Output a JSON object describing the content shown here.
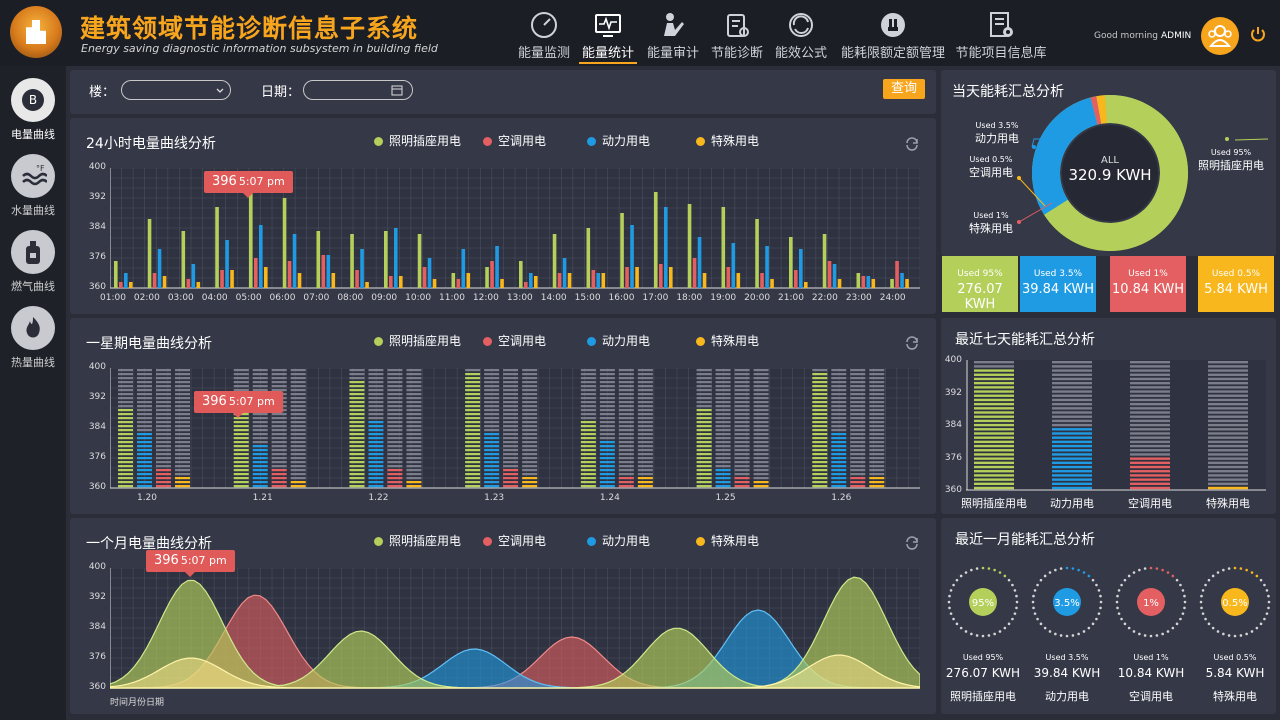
{
  "header": {
    "title": "建筑领域节能诊断信息子系统",
    "subtitle": "Energy saving diagnostic information subsystem in building field",
    "greeting": "Good morning",
    "user": "ADMIN"
  },
  "nav": [
    {
      "label": "能量监测",
      "icon": "gauge-icon"
    },
    {
      "label": "能量统计",
      "icon": "monitor-chart-icon",
      "active": true
    },
    {
      "label": "能量审计",
      "icon": "audit-icon"
    },
    {
      "label": "节能诊断",
      "icon": "clipboard-icon"
    },
    {
      "label": "能效公式",
      "icon": "globe-refresh-icon"
    },
    {
      "label": "能耗限额定额管理",
      "icon": "plug-icon"
    },
    {
      "label": "节能项目信息库",
      "icon": "document-gear-icon"
    }
  ],
  "sidebar": [
    {
      "label": "电量曲线",
      "icon": "electric-coin-icon",
      "active": true
    },
    {
      "label": "水量曲线",
      "icon": "water-temp-icon"
    },
    {
      "label": "燃气曲线",
      "icon": "gas-tank-icon"
    },
    {
      "label": "热量曲线",
      "icon": "flame-icon"
    }
  ],
  "filters": {
    "building_label": "楼：",
    "date_label": "日期：",
    "query": "查询"
  },
  "legend": [
    "照明插座用电",
    "空调用电",
    "动力用电",
    "特殊用电"
  ],
  "colors": {
    "lighting": "#b4cf5a",
    "ac": "#e35f61",
    "power": "#1f9be4",
    "special": "#f8b71c",
    "accent": "#f8a51e",
    "panel": "#353847"
  },
  "tooltip": {
    "value": "396",
    "time": "5:07 pm"
  },
  "daily": {
    "title": "24小时电量曲线分析",
    "yticks": [
      "400",
      "392",
      "384",
      "376",
      "360"
    ],
    "xticks": [
      "01:00",
      "02:00",
      "03:00",
      "04:00",
      "05:00",
      "06:00",
      "07:00",
      "08:00",
      "09:00",
      "10:00",
      "11:00",
      "12:00",
      "13:00",
      "14:00",
      "15:00",
      "16:00",
      "17:00",
      "18:00",
      "19:00",
      "20:00",
      "21:00",
      "22:00",
      "23:00",
      "24:00"
    ]
  },
  "weekly": {
    "title": "一星期电量曲线分析",
    "yticks": [
      "400",
      "392",
      "384",
      "376",
      "360"
    ],
    "xticks": [
      "1.20",
      "1.21",
      "1.22",
      "1.23",
      "1.24",
      "1.25",
      "1.26"
    ]
  },
  "monthly": {
    "title": "一个月电量曲线分析",
    "yticks": [
      "400",
      "392",
      "384",
      "376",
      "360"
    ],
    "xcaption": "时间月份日期"
  },
  "today": {
    "title": "当天能耗汇总分析",
    "center_label": "ALL",
    "center_value": "320.9 KWH",
    "items": [
      {
        "used": "Used 95%",
        "name": "照明插座用电",
        "value": "276.07 KWH",
        "color": "#b4cf5a"
      },
      {
        "used": "Used 3.5%",
        "name": "动力用电",
        "value": "39.84 KWH",
        "color": "#1f9be4"
      },
      {
        "used": "Used 1%",
        "name": "特殊用电",
        "value": "10.84 KWH",
        "color": "#e35f61"
      },
      {
        "used": "Used 0.5%",
        "name": "空调用电",
        "value": "5.84 KWH",
        "color": "#f8b71c"
      }
    ]
  },
  "seven": {
    "title": "最近七天能耗汇总分析",
    "yticks": [
      "400",
      "392",
      "384",
      "376",
      "360"
    ],
    "categories": [
      "照明插座用电",
      "动力用电",
      "空调用电",
      "特殊用电"
    ]
  },
  "month_summary": {
    "title": "最近一月能耗汇总分析",
    "items": [
      {
        "pct": "95%",
        "used": "Used 95%",
        "value": "276.07 KWH",
        "name": "照明插座用电",
        "color": "#b4cf5a"
      },
      {
        "pct": "3.5%",
        "used": "Used 3.5%",
        "value": "39.84 KWH",
        "name": "动力用电",
        "color": "#1f9be4"
      },
      {
        "pct": "1%",
        "used": "Used 1%",
        "value": "10.84 KWH",
        "name": "空调用电",
        "color": "#e35f61"
      },
      {
        "pct": "0.5%",
        "used": "Used 0.5%",
        "value": "5.84 KWH",
        "name": "特殊用电",
        "color": "#f8b71c"
      }
    ]
  },
  "chart_data": [
    {
      "type": "bar",
      "title": "24小时电量曲线分析",
      "categories": [
        "01:00",
        "02:00",
        "03:00",
        "04:00",
        "05:00",
        "06:00",
        "07:00",
        "08:00",
        "09:00",
        "10:00",
        "11:00",
        "12:00",
        "13:00",
        "14:00",
        "15:00",
        "16:00",
        "17:00",
        "18:00",
        "19:00",
        "20:00",
        "21:00",
        "22:00",
        "23:00",
        "24:00"
      ],
      "ylim": [
        360,
        400
      ],
      "series": [
        {
          "name": "照明插座用电",
          "values": [
            369,
            383,
            379,
            387,
            392,
            390,
            379,
            378,
            379,
            378,
            365,
            367,
            369,
            378,
            380,
            385,
            392,
            388,
            387,
            383,
            377,
            378,
            365,
            363
          ]
        },
        {
          "name": "空调用电",
          "values": [
            362,
            365,
            363,
            366,
            370,
            369,
            371,
            366,
            364,
            367,
            363,
            369,
            362,
            365,
            366,
            367,
            368,
            370,
            367,
            365,
            366,
            369,
            364,
            369
          ]
        },
        {
          "name": "动力用电",
          "values": [
            365,
            373,
            368,
            376,
            381,
            378,
            371,
            373,
            380,
            370,
            373,
            374,
            365,
            370,
            365,
            381,
            387,
            377,
            375,
            374,
            373,
            368,
            364,
            365
          ]
        },
        {
          "name": "特殊用电",
          "values": [
            362,
            364,
            362,
            366,
            367,
            365,
            365,
            362,
            364,
            363,
            365,
            363,
            364,
            365,
            365,
            367,
            367,
            365,
            365,
            363,
            362,
            363,
            363,
            363
          ]
        }
      ]
    },
    {
      "type": "bar",
      "title": "一星期电量曲线分析",
      "categories": [
        "1.20",
        "1.21",
        "1.22",
        "1.23",
        "1.24",
        "1.25",
        "1.26"
      ],
      "ylim": [
        360,
        400
      ],
      "series": [
        {
          "name": "照明插座用电",
          "values": [
            386,
            390,
            396,
            398,
            382,
            386,
            398
          ]
        },
        {
          "name": "动力用电",
          "values": [
            378,
            375,
            382,
            378,
            376,
            366,
            378
          ]
        },
        {
          "name": "空调用电",
          "values": [
            367,
            366,
            367,
            366,
            364,
            364,
            364
          ]
        },
        {
          "name": "特殊用电",
          "values": [
            364,
            362,
            363,
            364,
            364,
            362,
            364
          ]
        }
      ]
    },
    {
      "type": "area",
      "title": "一个月电量曲线分析",
      "ylim": [
        360,
        400
      ],
      "series": [
        {
          "name": "照明插座用电",
          "peaks": [
            [
              0.1,
              396
            ],
            [
              0.31,
              379
            ],
            [
              0.7,
              380
            ],
            [
              0.92,
              397
            ]
          ]
        },
        {
          "name": "动力用电",
          "peaks": [
            [
              0.18,
              391
            ],
            [
              0.57,
              377
            ]
          ]
        },
        {
          "name": "空调用电",
          "peaks": [
            [
              0.45,
              373
            ],
            [
              0.8,
              386
            ]
          ]
        },
        {
          "name": "特殊用电",
          "peaks": [
            [
              0.1,
              370
            ],
            [
              0.9,
              371
            ]
          ]
        }
      ]
    },
    {
      "type": "pie",
      "title": "当天能耗汇总分析",
      "categories": [
        "照明插座用电",
        "动力用电",
        "空调用电",
        "特殊用电"
      ],
      "values": [
        95,
        3.5,
        0.5,
        1
      ]
    },
    {
      "type": "bar",
      "title": "最近七天能耗汇总分析",
      "categories": [
        "照明插座用电",
        "动力用电",
        "空调用电",
        "特殊用电"
      ],
      "values": [
        398,
        379,
        370,
        361
      ],
      "ylim": [
        360,
        400
      ]
    }
  ]
}
